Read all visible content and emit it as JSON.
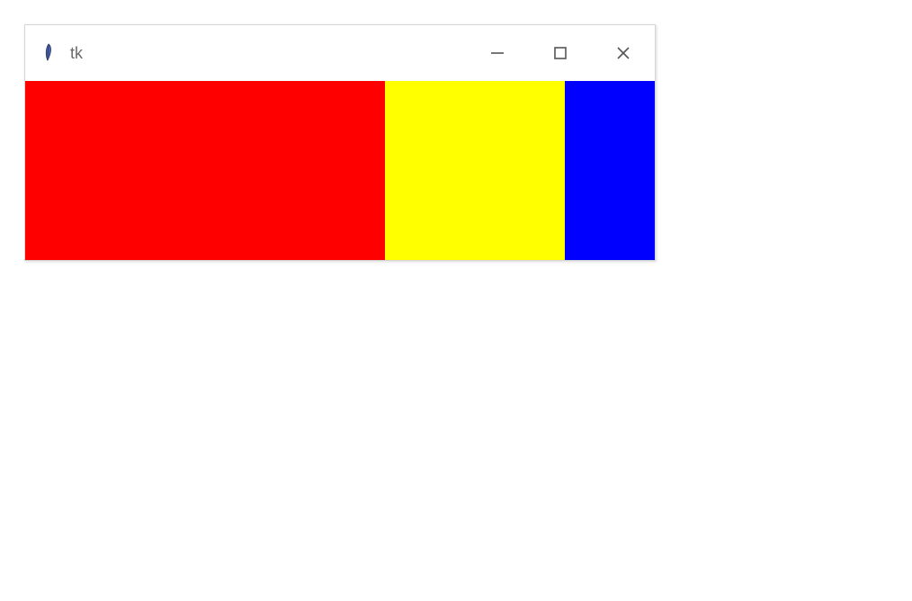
{
  "window": {
    "title": "tk",
    "icon_label": "feather-icon"
  },
  "controls": {
    "minimize_name": "minimize-button",
    "maximize_name": "maximize-button",
    "close_name": "close-button"
  },
  "panels": [
    {
      "name": "panel-red",
      "color": "#ff0000"
    },
    {
      "name": "panel-yellow",
      "color": "#ffff00"
    },
    {
      "name": "panel-blue",
      "color": "#0000ff"
    }
  ]
}
